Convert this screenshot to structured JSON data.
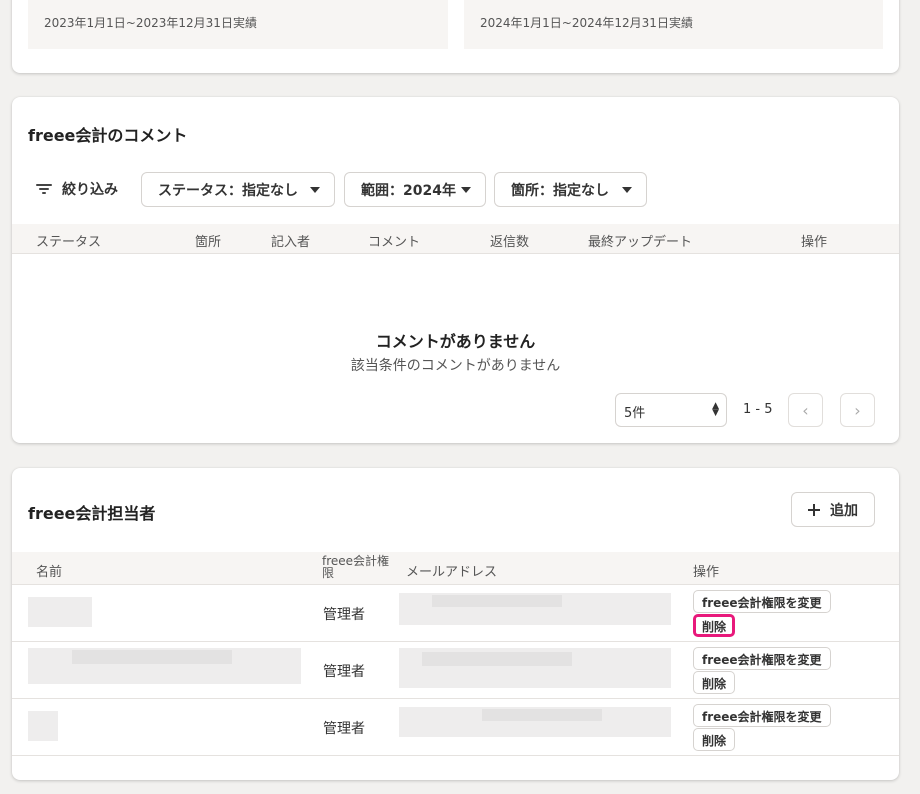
{
  "summary": {
    "period_2023": "2023年1月1日~2023年12月31日実績",
    "period_2024": "2024年1月1日~2024年12月31日実績"
  },
  "comments": {
    "title": "freee会計のコメント",
    "filter_label": "絞り込み",
    "filters": {
      "status": "ステータス：指定なし",
      "range": "範囲：2024年",
      "place": "箇所：指定なし"
    },
    "columns": [
      "ステータス",
      "箇所",
      "記入者",
      "コメント",
      "返信数",
      "最終アップデート",
      "操作"
    ],
    "empty_title": "コメントがありません",
    "empty_subtitle": "該当条件のコメントがありません",
    "per_page": "5件",
    "range_text": "1 - 5",
    "prev_icon": "‹",
    "next_icon": "›"
  },
  "staff": {
    "title": "freee会計担当者",
    "add_label": "追加",
    "columns": {
      "name": "名前",
      "auth": "freee会計権限",
      "email": "メールアドレス",
      "ops": "操作"
    },
    "rows": [
      {
        "role": "管理者",
        "change_label": "freee会計権限を変更",
        "delete_label": "削除"
      },
      {
        "role": "管理者",
        "change_label": "freee会計権限を変更",
        "delete_label": "削除"
      },
      {
        "role": "管理者",
        "change_label": "freee会計権限を変更",
        "delete_label": "削除"
      }
    ]
  },
  "colors": {
    "highlight": "#e8197b",
    "background": "#f2f1ef",
    "table_header": "#f7f5f3"
  }
}
